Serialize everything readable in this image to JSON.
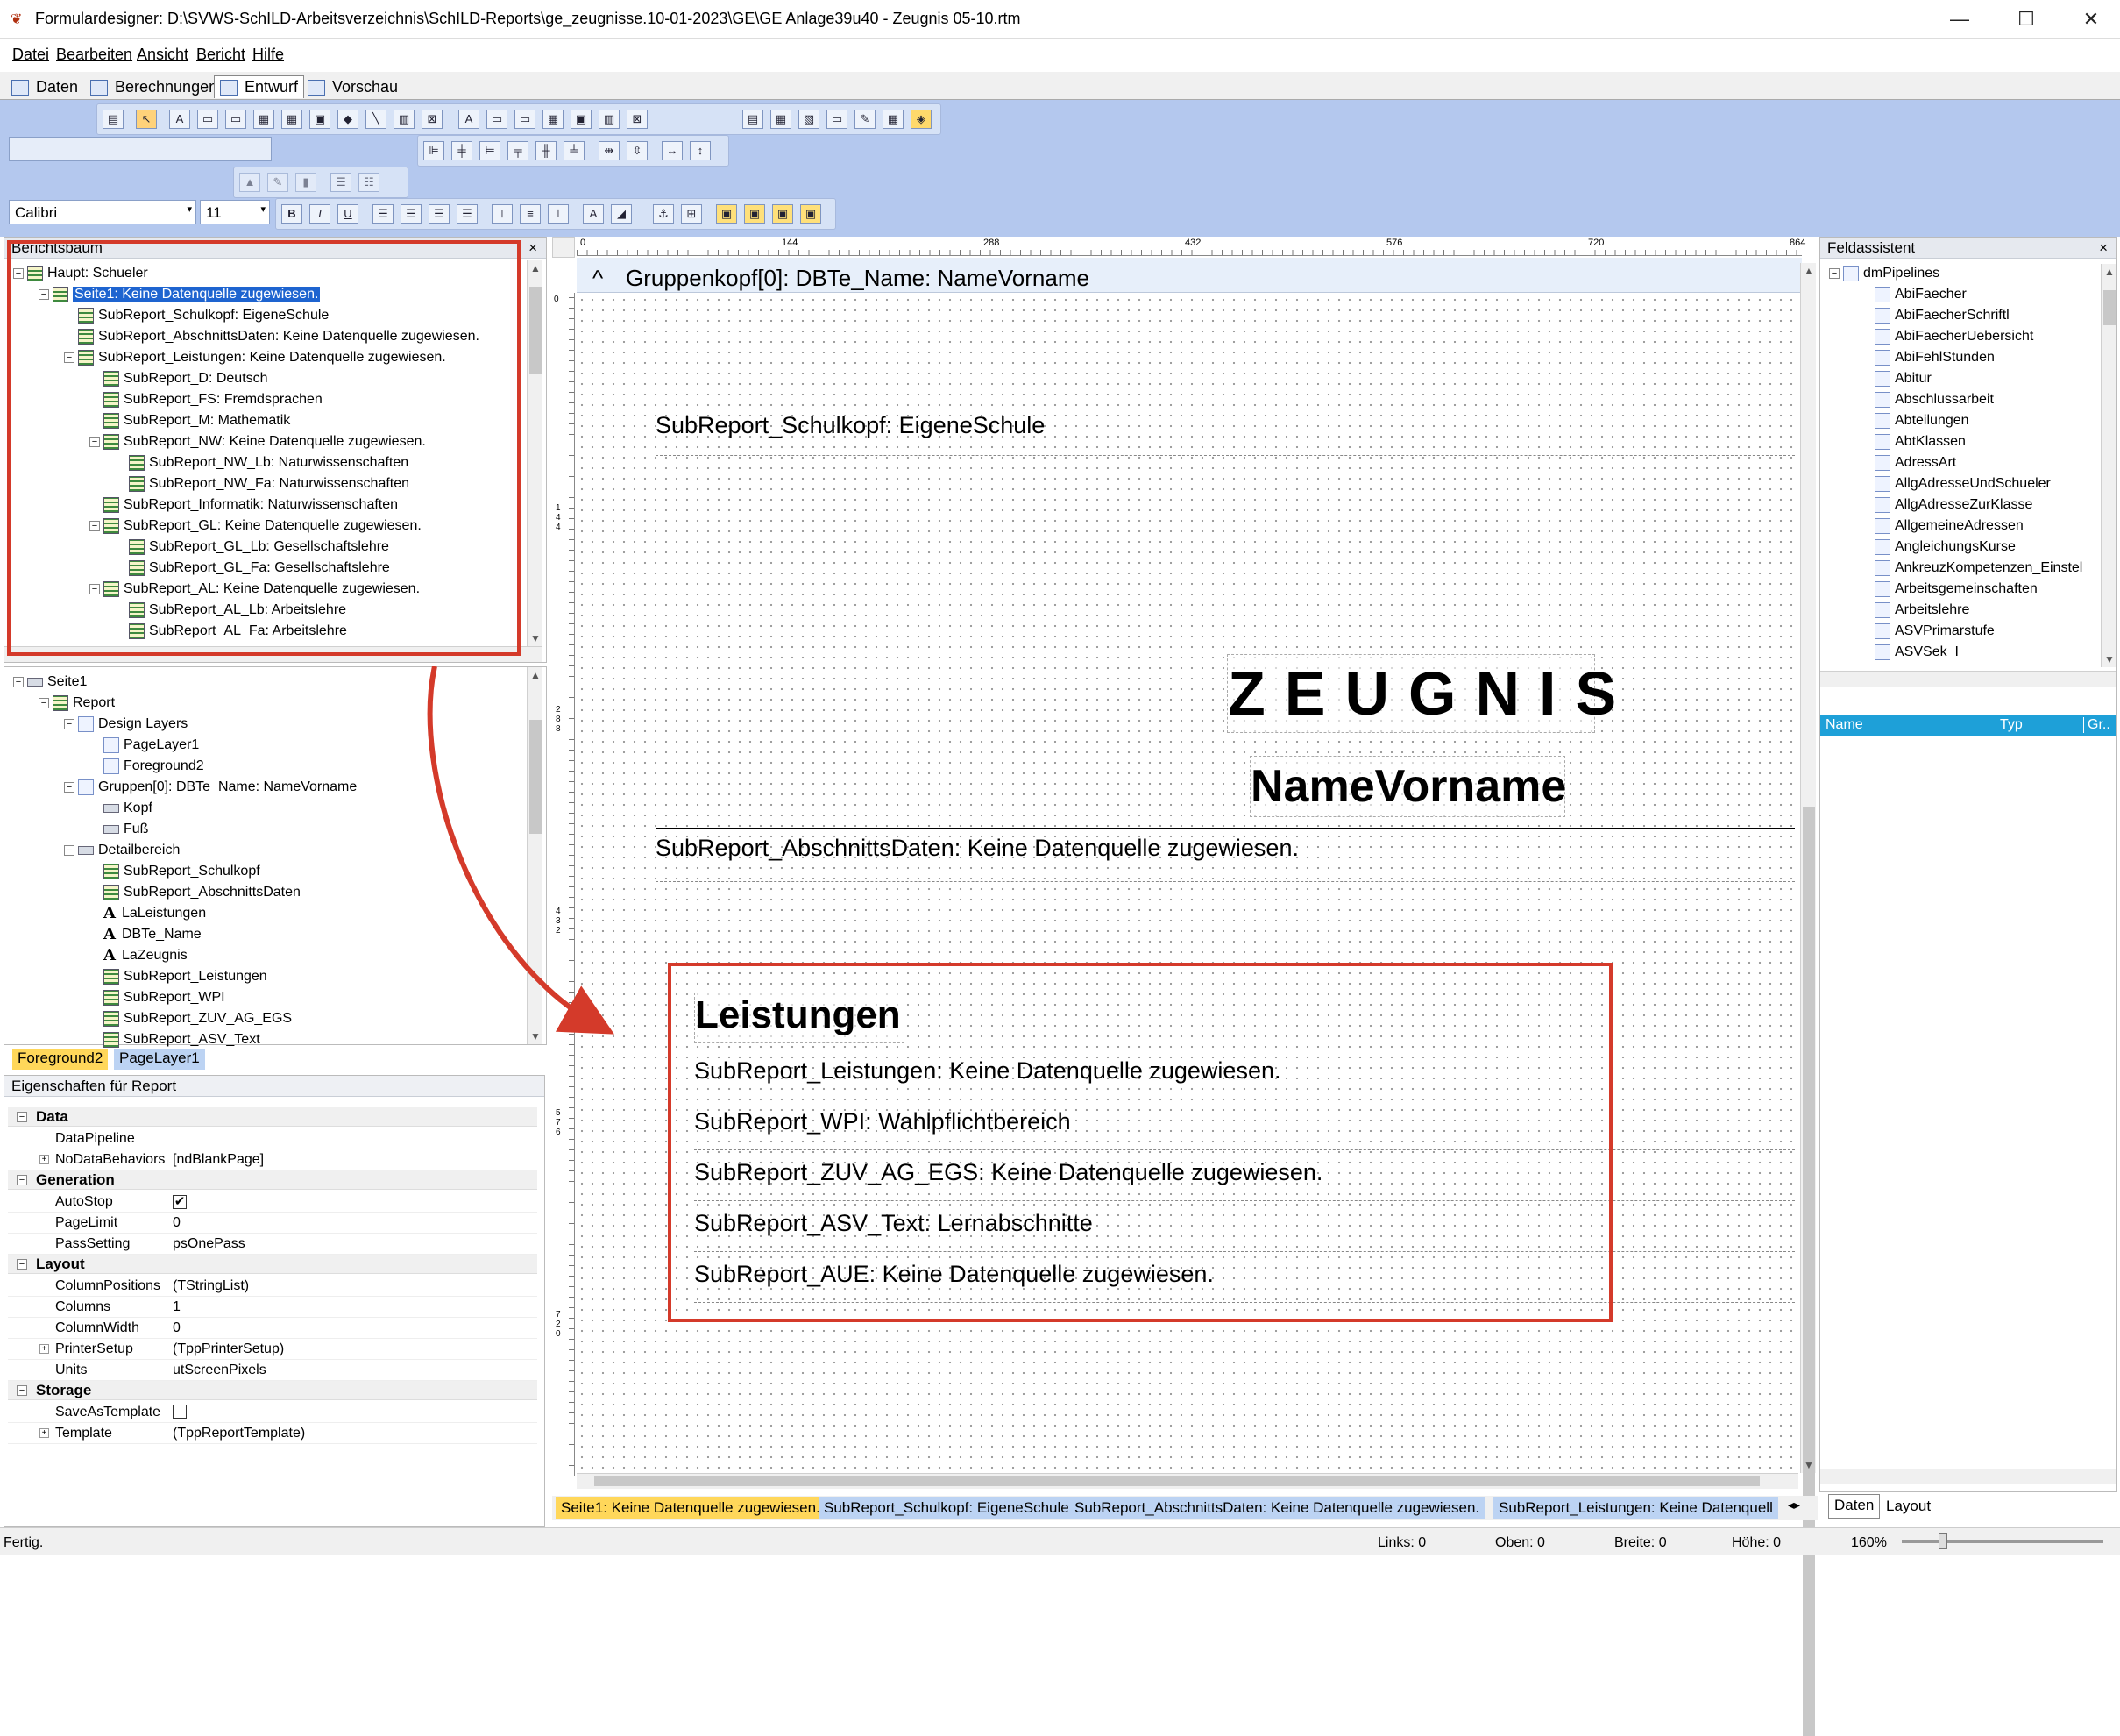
{
  "window": {
    "title": "Formulardesigner: D:\\SVWS-SchILD-Arbeitsverzeichnis\\SchILD-Reports\\ge_zeugnisse.10-01-2023\\GE\\GE Anlage39u40 - Zeugnis 05-10.rtm",
    "minimize": "—",
    "maximize": "☐",
    "close": "✕"
  },
  "menu": [
    "Datei",
    "Bearbeiten",
    "Ansicht",
    "Bericht",
    "Hilfe"
  ],
  "view_tabs": [
    "Daten",
    "Berechnungen",
    "Entwurf",
    "Vorschau"
  ],
  "format": {
    "font": "Calibri",
    "size": "11"
  },
  "berichtsbaum": {
    "title": "Berichtsbaum",
    "items": [
      "Haupt: Schueler",
      "Seite1: Keine Datenquelle zugewiesen.",
      "SubReport_Schulkopf: EigeneSchule",
      "SubReport_AbschnittsDaten: Keine Datenquelle zugewiesen.",
      "SubReport_Leistungen: Keine Datenquelle zugewiesen.",
      "SubReport_D: Deutsch",
      "SubReport_FS: Fremdsprachen",
      "SubReport_M: Mathematik",
      "SubReport_NW: Keine Datenquelle zugewiesen.",
      "SubReport_NW_Lb: Naturwissenschaften",
      "SubReport_NW_Fa: Naturwissenschaften",
      "SubReport_Informatik: Naturwissenschaften",
      "SubReport_GL: Keine Datenquelle zugewiesen.",
      "SubReport_GL_Lb: Gesellschaftslehre",
      "SubReport_GL_Fa: Gesellschaftslehre",
      "SubReport_AL: Keine Datenquelle zugewiesen.",
      "SubReport_AL_Lb: Arbeitslehre",
      "SubReport_AL_Fa: Arbeitslehre"
    ]
  },
  "objekttree": {
    "items": [
      "Seite1",
      "Report",
      "Design Layers",
      "PageLayer1",
      "Foreground2",
      "Gruppen[0]: DBTe_Name: NameVorname",
      "Kopf",
      "Fuß",
      "Detailbereich",
      "SubReport_Schulkopf",
      "SubReport_AbschnittsDaten",
      "LaLeistungen",
      "DBTe_Name",
      "LaZeugnis",
      "SubReport_Leistungen",
      "SubReport_WPI",
      "SubReport_ZUV_AG_EGS",
      "SubReport_ASV_Text"
    ],
    "layer_tabs": [
      "Foreground2",
      "PageLayer1"
    ]
  },
  "properties": {
    "title": "Eigenschaften für Report",
    "sections": [
      {
        "name": "Data",
        "rows": [
          {
            "name": "DataPipeline",
            "value": ""
          },
          {
            "name": "NoDataBehaviors",
            "value": "[ndBlankPage]"
          }
        ]
      },
      {
        "name": "Generation",
        "rows": [
          {
            "name": "AutoStop",
            "value": "✔"
          },
          {
            "name": "PageLimit",
            "value": "0"
          },
          {
            "name": "PassSetting",
            "value": "psOnePass"
          }
        ]
      },
      {
        "name": "Layout",
        "rows": [
          {
            "name": "ColumnPositions",
            "value": "(TStringList)"
          },
          {
            "name": "Columns",
            "value": "1"
          },
          {
            "name": "ColumnWidth",
            "value": "0"
          },
          {
            "name": "PrinterSetup",
            "value": "(TppPrinterSetup)"
          },
          {
            "name": "Units",
            "value": "utScreenPixels"
          }
        ]
      },
      {
        "name": "Storage",
        "rows": [
          {
            "name": "SaveAsTemplate",
            "value": ""
          },
          {
            "name": "Template",
            "value": "(TppReportTemplate)"
          }
        ]
      }
    ]
  },
  "ruler": {
    "ticks": [
      "0",
      "144",
      "288",
      "432",
      "576",
      "720",
      "864"
    ],
    "vticks": [
      "1 4 4",
      "2 8 8",
      "4 3 2",
      "5 7 6",
      "7 2 0"
    ]
  },
  "design": {
    "band_header": "Gruppenkopf[0]: DBTe_Name: NameVorname",
    "band_caret": "^",
    "schulkopf": "SubReport_Schulkopf: EigeneSchule",
    "zeugnis": "ZEUGNIS",
    "namevorname": "NameVorname",
    "abschnittsdaten": "SubReport_AbschnittsDaten: Keine Datenquelle zugewiesen.",
    "leistungen_title": "Leistungen",
    "subreports": [
      "SubReport_Leistungen: Keine Datenquelle zugewiesen.",
      "SubReport_WPI: Wahlpflichtbereich",
      "SubReport_ZUV_AG_EGS: Keine Datenquelle zugewiesen.",
      "SubReport_ASV_Text: Lernabschnitte",
      "SubReport_AUE: Keine Datenquelle zugewiesen."
    ]
  },
  "report_tabs": [
    "Seite1: Keine Datenquelle zugewiesen.",
    "SubReport_Schulkopf: EigeneSchule",
    "SubReport_AbschnittsDaten: Keine Datenquelle zugewiesen.",
    "SubReport_Leistungen: Keine Datenquell"
  ],
  "feldassistent": {
    "title": "Feldassistent",
    "root": "dmPipelines",
    "items": [
      "AbiFaecher",
      "AbiFaecherSchriftl",
      "AbiFaecherUebersicht",
      "AbiFehlStunden",
      "Abitur",
      "Abschlussarbeit",
      "Abteilungen",
      "AbtKlassen",
      "AdressArt",
      "AllgAdresseUndSchueler",
      "AllgAdresseZurKlasse",
      "AllgemeineAdressen",
      "AngleichungsKurse",
      "AnkreuzKompetenzen_Einstel",
      "Arbeitsgemeinschaften",
      "Arbeitslehre",
      "ASVPrimarstufe",
      "ASVSek_I"
    ],
    "columns": [
      "Name",
      "Typ",
      "Gr.."
    ],
    "tabs": [
      "Daten",
      "Layout"
    ]
  },
  "statusbar": {
    "status": "Fertig.",
    "links": "Links: 0",
    "oben": "Oben: 0",
    "breite": "Breite: 0",
    "hoehe": "Höhe: 0",
    "zoom": "160%"
  },
  "colors": {
    "accent": "#1e64d0",
    "toolbar": "#b4c8ee",
    "highlight_red": "#d43a2a",
    "tab_yellow": "#ffd75a",
    "tab_blue": "#bcd3f3"
  }
}
